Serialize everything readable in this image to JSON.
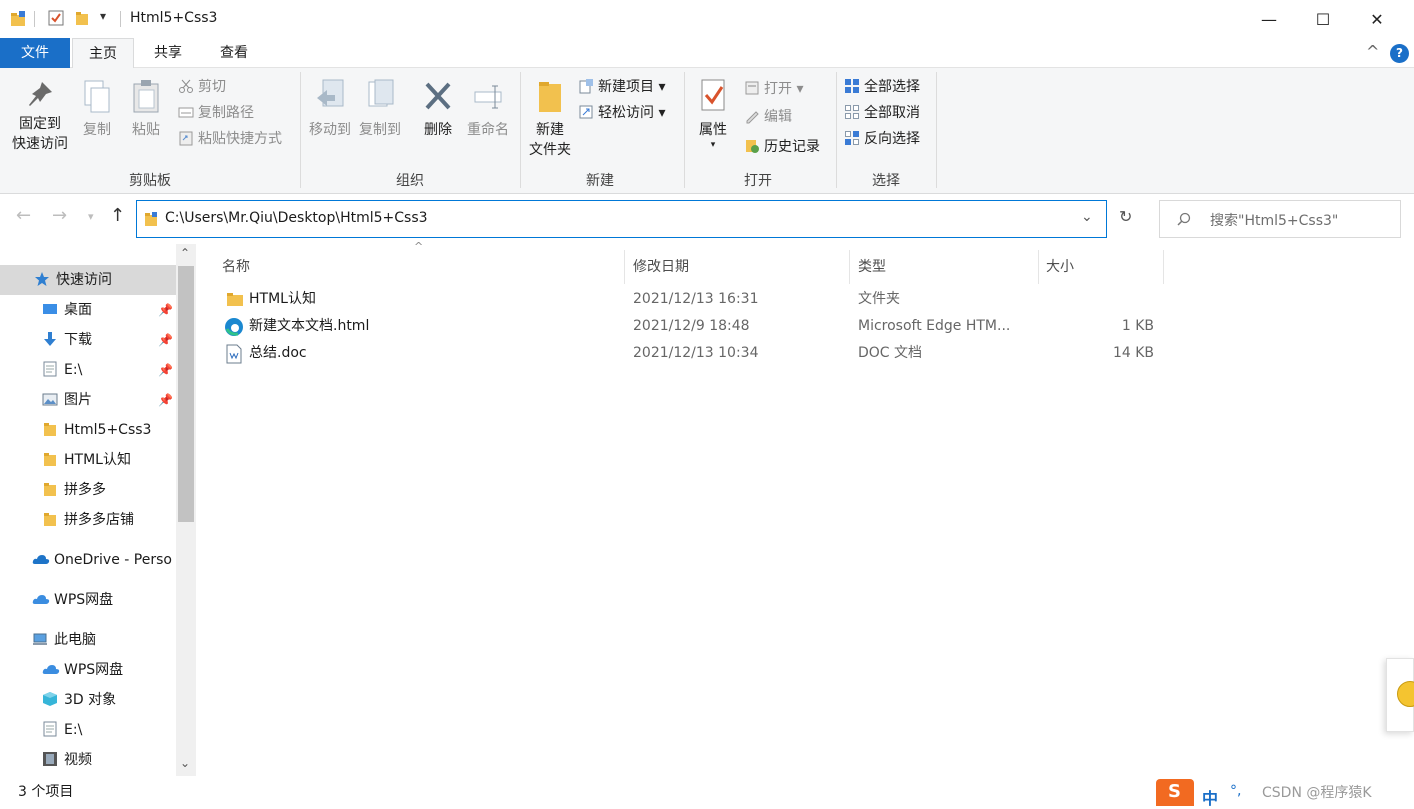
{
  "window": {
    "title": "Html5+Css3",
    "quick_access_dropdown": "▾",
    "minimize_glyph": "—",
    "maximize_glyph": "☐",
    "close_glyph": "✕"
  },
  "tabs": {
    "file": "文件",
    "home": "主页",
    "share": "共享",
    "view": "查看",
    "expand_glyph": "^",
    "help_glyph": "?"
  },
  "ribbon": {
    "clipboard": {
      "label": "剪贴板",
      "pin_line1": "固定到",
      "pin_line2": "快速访问",
      "copy": "复制",
      "paste": "粘贴",
      "cut": "剪切",
      "copy_path": "复制路径",
      "paste_shortcut": "粘贴快捷方式"
    },
    "organize": {
      "label": "组织",
      "move_to": "移动到",
      "copy_to": "复制到",
      "delete": "删除",
      "rename": "重命名"
    },
    "new": {
      "label": "新建",
      "new_folder_line1": "新建",
      "new_folder_line2": "文件夹",
      "new_item": "新建项目",
      "easy_access": "轻松访问"
    },
    "open": {
      "label": "打开",
      "properties": "属性",
      "open": "打开",
      "edit": "编辑",
      "history": "历史记录"
    },
    "select": {
      "label": "选择",
      "select_all": "全部选择",
      "select_none": "全部取消",
      "invert": "反向选择"
    }
  },
  "address": {
    "path": "C:\\Users\\Mr.Qiu\\Desktop\\Html5+Css3",
    "search_placeholder": "搜索\"Html5+Css3\""
  },
  "sidebar": {
    "items": [
      {
        "label": "快速访问",
        "icon": "star-icon",
        "pinned": false
      },
      {
        "label": "桌面",
        "icon": "desktop-icon",
        "pinned": true
      },
      {
        "label": "下载",
        "icon": "download-icon",
        "pinned": true
      },
      {
        "label": "E:\\",
        "icon": "document-icon",
        "pinned": true
      },
      {
        "label": "图片",
        "icon": "pictures-icon",
        "pinned": true
      },
      {
        "label": "Html5+Css3",
        "icon": "folder-icon",
        "pinned": false
      },
      {
        "label": "HTML认知",
        "icon": "folder-icon",
        "pinned": false
      },
      {
        "label": "拼多多",
        "icon": "folder-icon",
        "pinned": false
      },
      {
        "label": "拼多多店铺",
        "icon": "folder-icon",
        "pinned": false
      },
      {
        "label": "OneDrive - Perso",
        "icon": "onedrive-icon",
        "pinned": false
      },
      {
        "label": "WPS网盘",
        "icon": "cloud-icon",
        "pinned": false
      },
      {
        "label": "此电脑",
        "icon": "computer-icon",
        "pinned": false
      },
      {
        "label": "WPS网盘",
        "icon": "cloud-icon",
        "pinned": false
      },
      {
        "label": "3D 对象",
        "icon": "cube-icon",
        "pinned": false
      },
      {
        "label": "E:\\",
        "icon": "document-icon",
        "pinned": false
      },
      {
        "label": "视频",
        "icon": "video-icon",
        "pinned": false
      }
    ]
  },
  "filelist": {
    "columns": {
      "name": "名称",
      "modified": "修改日期",
      "type": "类型",
      "size": "大小"
    },
    "rows": [
      {
        "name": "HTML认知",
        "modified": "2021/12/13 16:31",
        "type": "文件夹",
        "size": "",
        "icon": "folder-icon"
      },
      {
        "name": "新建文本文档.html",
        "modified": "2021/12/9 18:48",
        "type": "Microsoft Edge HTM...",
        "size": "1 KB",
        "icon": "edge-icon"
      },
      {
        "name": "总结.doc",
        "modified": "2021/12/13 10:34",
        "type": "DOC 文档",
        "size": "14 KB",
        "icon": "doc-icon"
      }
    ]
  },
  "status": {
    "count": "3 个项目",
    "ime_label": "中",
    "watermark": "CSDN @程序猿K"
  },
  "colors": {
    "accent": "#1a6fc8",
    "folder": "#f2c14e",
    "ribbon_bg": "#f5f6f7",
    "selected_bg": "#cce8ff"
  }
}
